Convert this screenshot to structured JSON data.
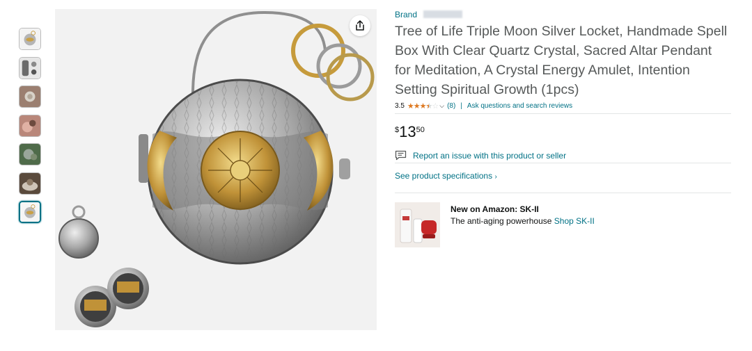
{
  "product": {
    "brand_label": "Brand",
    "title": "Tree of Life Triple Moon Silver Locket, Handmade Spell Box With Clear Quartz Crystal, Sacred Altar Pendant for Meditation, A Crystal Energy Amulet, Intention Setting Spiritual Growth (1pcs)",
    "rating": "3.5",
    "rating_value": 3.5,
    "rating_count": "(8)",
    "ask_link": "Ask questions and search reviews",
    "price_symbol": "$",
    "price_whole": "13",
    "price_fraction": "50",
    "report_link": "Report an issue with this product or seller",
    "specs_link": "See product specifications"
  },
  "gallery": {
    "thumbnail_count": 7,
    "selected_index": 6
  },
  "ad": {
    "title": "New on Amazon: SK-II",
    "text": "The anti-aging powerhouse",
    "link": "Shop SK-II"
  },
  "colors": {
    "link": "#007185",
    "star": "#de7921",
    "title": "#565959",
    "selected_border": "#007185"
  },
  "icons": {
    "share": "share-icon",
    "report": "message-icon",
    "chevron": "chevron-down-icon"
  }
}
